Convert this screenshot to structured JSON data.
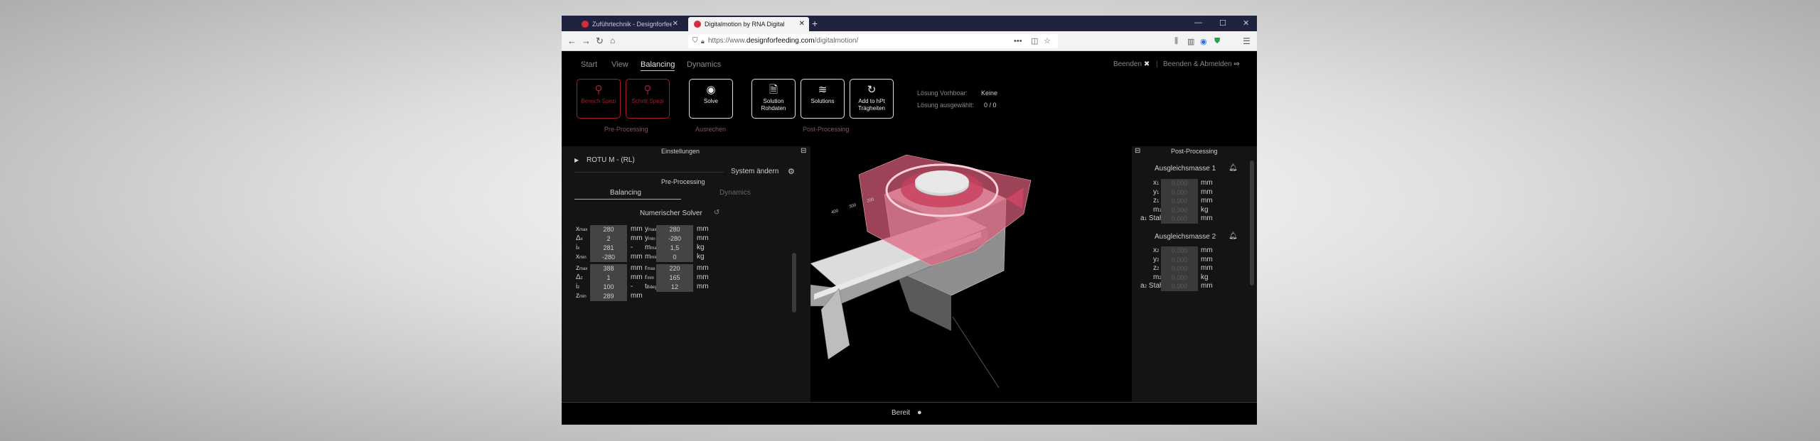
{
  "browser": {
    "tabs": [
      {
        "title": "Zuführtechnik - Designforfeedi"
      },
      {
        "title": "Digitalmotion by RNA Digital"
      }
    ],
    "url_prefix": "https://www.",
    "url_domain": "designforfeeding.com",
    "url_path": "/digitalmotion/"
  },
  "menu": {
    "tabs": [
      "Start",
      "View",
      "Balancing",
      "Dynamics"
    ],
    "active": "Balancing",
    "exit": "Beenden",
    "exit_logout": "Beenden & Abmelden"
  },
  "toolbar": {
    "tools": [
      {
        "label": "Bereich Spezi",
        "icon": "search-icon"
      },
      {
        "label": "Schritt Spezi",
        "icon": "search-icon"
      },
      {
        "label": "Solve",
        "icon": "play-circle-icon"
      },
      {
        "label": "Solution Rohdaten",
        "icon": "document-icon"
      },
      {
        "label": "Solutions",
        "icon": "layers-icon"
      },
      {
        "label": "Add to hPt Trägheiten",
        "icon": "refresh-icon"
      }
    ],
    "groups": [
      "Pre-Processing",
      "Ausrechen",
      "Post-Processing"
    ],
    "info": [
      {
        "k": "Lösung Vorhboar:",
        "v": "Keine"
      },
      {
        "k": "Lösung ausgewählt:",
        "v": "0 / 0"
      }
    ]
  },
  "left": {
    "header": "Einstellungen",
    "tree_item": "ROTU M - (RL)",
    "system_change": "System ändern",
    "pre_processing": "Pre-Processing",
    "tabs": [
      "Balancing",
      "Dynamics"
    ],
    "solver": "Numerischer Solver",
    "params_left": [
      {
        "sym": "x",
        "sub": "max",
        "val": "280",
        "unit": "mm"
      },
      {
        "sym": "Δ",
        "sub": "x",
        "val": "2",
        "unit": "mm"
      },
      {
        "sym": "i",
        "sub": "x",
        "val": "281",
        "unit": "-"
      },
      {
        "sym": "x",
        "sub": "min",
        "val": "-280",
        "unit": "mm"
      },
      {
        "sym": "z",
        "sub": "max",
        "val": "388",
        "unit": "mm"
      },
      {
        "sym": "Δ",
        "sub": "z",
        "val": "1",
        "unit": "mm"
      },
      {
        "sym": "i",
        "sub": "z",
        "val": "100",
        "unit": "-"
      },
      {
        "sym": "z",
        "sub": "min",
        "val": "289",
        "unit": "mm"
      }
    ],
    "params_right": [
      {
        "sym": "y",
        "sub": "max",
        "val": "280",
        "unit": "mm"
      },
      {
        "sym": "y",
        "sub": "min",
        "val": "-280",
        "unit": "mm"
      },
      {
        "sym": "m",
        "sub": "max",
        "val": "1,5",
        "unit": "kg"
      },
      {
        "sym": "m",
        "sub": "min",
        "val": "0",
        "unit": "kg"
      },
      {
        "sym": "r",
        "sub": "max",
        "val": "220",
        "unit": "mm"
      },
      {
        "sym": "r",
        "sub": "min",
        "val": "165",
        "unit": "mm"
      },
      {
        "sym": "t",
        "sub": "Bdeg",
        "val": "12",
        "unit": "mm"
      }
    ]
  },
  "right": {
    "header": "Post-Processing",
    "mass1": {
      "title": "Ausgleichsmasse 1",
      "rows": [
        {
          "sym": "x",
          "sub": "1",
          "ph": "0,000",
          "unit": "mm"
        },
        {
          "sym": "y",
          "sub": "1",
          "ph": "0,000",
          "unit": "mm"
        },
        {
          "sym": "z",
          "sub": "1",
          "ph": "0,000",
          "unit": "mm"
        },
        {
          "sym": "m",
          "sub": "1",
          "ph": "0,000",
          "unit": "kg"
        },
        {
          "sym": "a",
          "sub": "1",
          "suffix": "Stahl",
          "ph": "0,000",
          "unit": "mm"
        }
      ]
    },
    "mass2": {
      "title": "Ausgleichsmasse 2",
      "rows": [
        {
          "sym": "x",
          "sub": "2",
          "ph": "0,000",
          "unit": "mm"
        },
        {
          "sym": "y",
          "sub": "2",
          "ph": "0,000",
          "unit": "mm"
        },
        {
          "sym": "z",
          "sub": "2",
          "ph": "0,000",
          "unit": "mm"
        },
        {
          "sym": "m",
          "sub": "2",
          "ph": "0,000",
          "unit": "kg"
        },
        {
          "sym": "a",
          "sub": "2",
          "suffix": "Stahl",
          "ph": "0,000",
          "unit": "mm"
        }
      ]
    }
  },
  "status": {
    "text": "Bereit"
  },
  "colors": {
    "accent": "#a21d2a",
    "panel": "#141414",
    "titlebar": "#202340"
  }
}
